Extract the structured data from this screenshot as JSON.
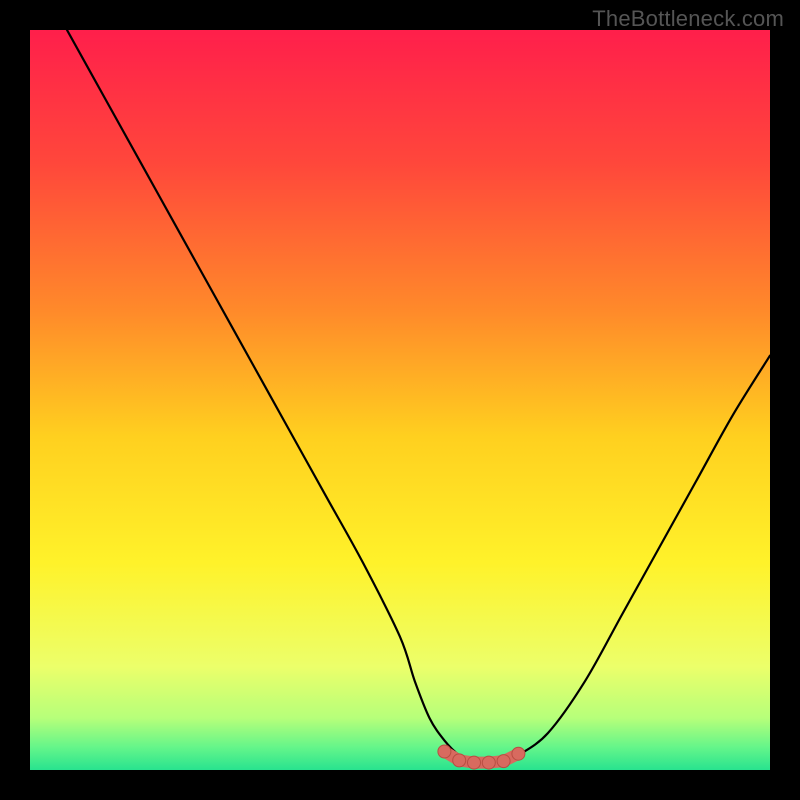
{
  "watermark": "TheBottleneck.com",
  "colors": {
    "frame_bg": "#000000",
    "watermark_text": "#555555",
    "curve_stroke": "#000000",
    "marker_fill": "#d86a5f",
    "marker_stroke": "#b84d42"
  },
  "chart_data": {
    "type": "line",
    "title": "",
    "xlabel": "",
    "ylabel": "",
    "xlim": [
      0,
      100
    ],
    "ylim": [
      0,
      100
    ],
    "gradient_stops": [
      {
        "offset": 0.0,
        "color": "#ff1f4b"
      },
      {
        "offset": 0.18,
        "color": "#ff473b"
      },
      {
        "offset": 0.38,
        "color": "#ff8a2a"
      },
      {
        "offset": 0.55,
        "color": "#ffd01f"
      },
      {
        "offset": 0.72,
        "color": "#fff22a"
      },
      {
        "offset": 0.86,
        "color": "#ecff6a"
      },
      {
        "offset": 0.93,
        "color": "#b6ff7a"
      },
      {
        "offset": 0.97,
        "color": "#63f58a"
      },
      {
        "offset": 1.0,
        "color": "#28e38f"
      }
    ],
    "series": [
      {
        "name": "bottleneck-curve",
        "x": [
          5,
          10,
          15,
          20,
          25,
          30,
          35,
          40,
          45,
          50,
          52,
          54,
          56,
          58,
          60,
          62,
          64,
          66,
          70,
          75,
          80,
          85,
          90,
          95,
          100
        ],
        "y": [
          100,
          91,
          82,
          73,
          64,
          55,
          46,
          37,
          28,
          18,
          12,
          7,
          4,
          2,
          1,
          1,
          1,
          2,
          5,
          12,
          21,
          30,
          39,
          48,
          56
        ]
      }
    ],
    "optimal_markers": {
      "name": "optimal-zone",
      "x": [
        56,
        58,
        60,
        62,
        64,
        66
      ],
      "y": [
        2.5,
        1.3,
        1.0,
        1.0,
        1.2,
        2.2
      ]
    }
  }
}
